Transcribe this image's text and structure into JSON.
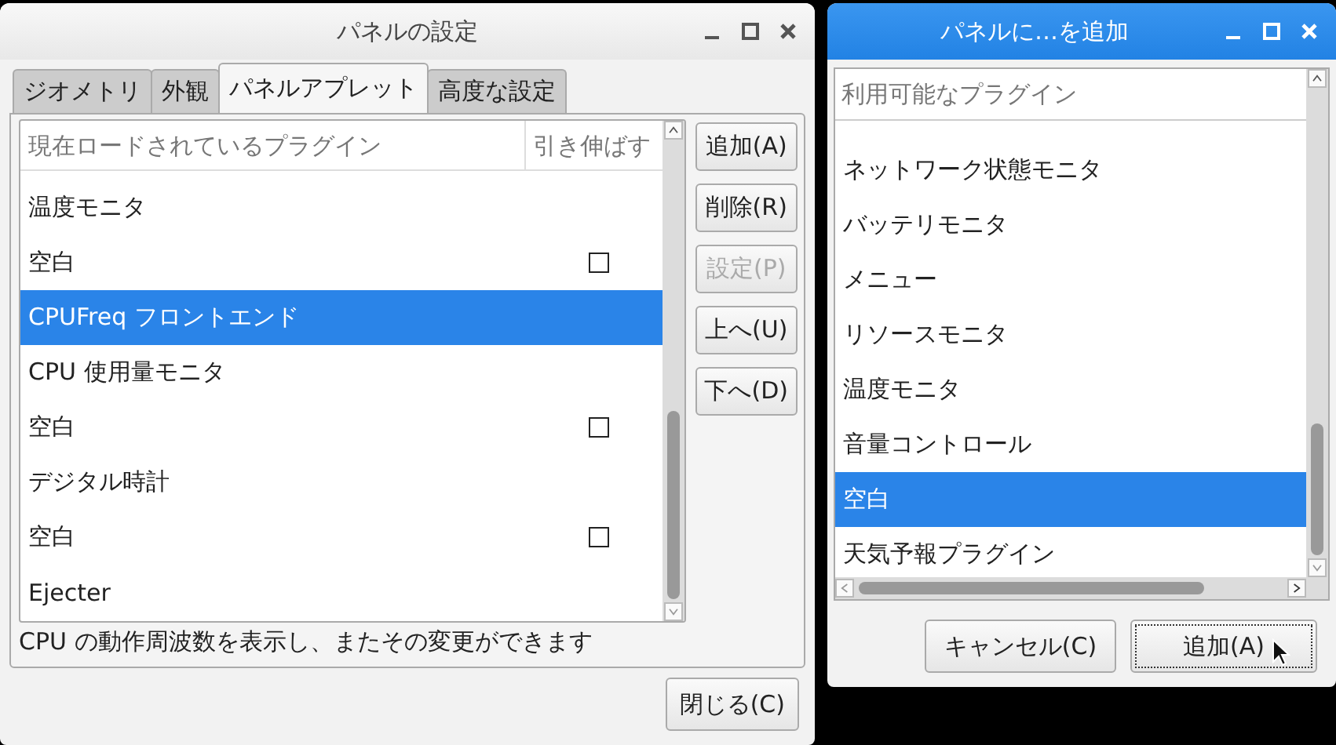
{
  "settings_window": {
    "title": "パネルの設定",
    "tabs": [
      {
        "label": "ジオメトリ",
        "selected": false
      },
      {
        "label": "外観",
        "selected": false
      },
      {
        "label": "パネルアプレット",
        "selected": true
      },
      {
        "label": "高度な設定",
        "selected": false
      }
    ],
    "plugin_list": {
      "columns": [
        "現在ロードされているプラグイン",
        "引き伸ばす"
      ],
      "rows": [
        {
          "name": "温度モニタ",
          "kind": "plain",
          "selected": false
        },
        {
          "name": "空白",
          "kind": "checkbox",
          "checked": false,
          "selected": false
        },
        {
          "name": "CPUFreq フロントエンド",
          "kind": "plain",
          "selected": true
        },
        {
          "name": "CPU 使用量モニタ",
          "kind": "plain",
          "selected": false
        },
        {
          "name": "空白",
          "kind": "checkbox",
          "checked": false,
          "selected": false
        },
        {
          "name": "デジタル時計",
          "kind": "plain",
          "selected": false
        },
        {
          "name": "空白",
          "kind": "checkbox",
          "checked": false,
          "selected": false
        },
        {
          "name": "Ejecter",
          "kind": "plain",
          "selected": false
        }
      ]
    },
    "side_buttons": [
      {
        "label": "追加(A)",
        "disabled": false
      },
      {
        "label": "削除(R)",
        "disabled": false
      },
      {
        "label": "設定(P)",
        "disabled": true
      },
      {
        "label": "上へ(U)",
        "disabled": false
      },
      {
        "label": "下へ(D)",
        "disabled": false
      }
    ],
    "description": "CPU の動作周波数を表示し、またその変更ができます",
    "close_button": "閉じる(C)"
  },
  "add_window": {
    "title": "パネルに…を追加",
    "list_header": "利用可能なプラグイン",
    "items": [
      {
        "name": "ネットワーク状態モニタ",
        "selected": false
      },
      {
        "name": "バッテリモニタ",
        "selected": false
      },
      {
        "name": "メニュー",
        "selected": false
      },
      {
        "name": "リソースモニタ",
        "selected": false
      },
      {
        "name": "温度モニタ",
        "selected": false
      },
      {
        "name": "音量コントロール",
        "selected": false
      },
      {
        "name": "空白",
        "selected": true
      },
      {
        "name": "天気予報プラグイン",
        "selected": false
      }
    ],
    "buttons": [
      {
        "label": "キャンセル(C)",
        "focused": false
      },
      {
        "label": "追加(A)",
        "focused": true
      }
    ]
  }
}
